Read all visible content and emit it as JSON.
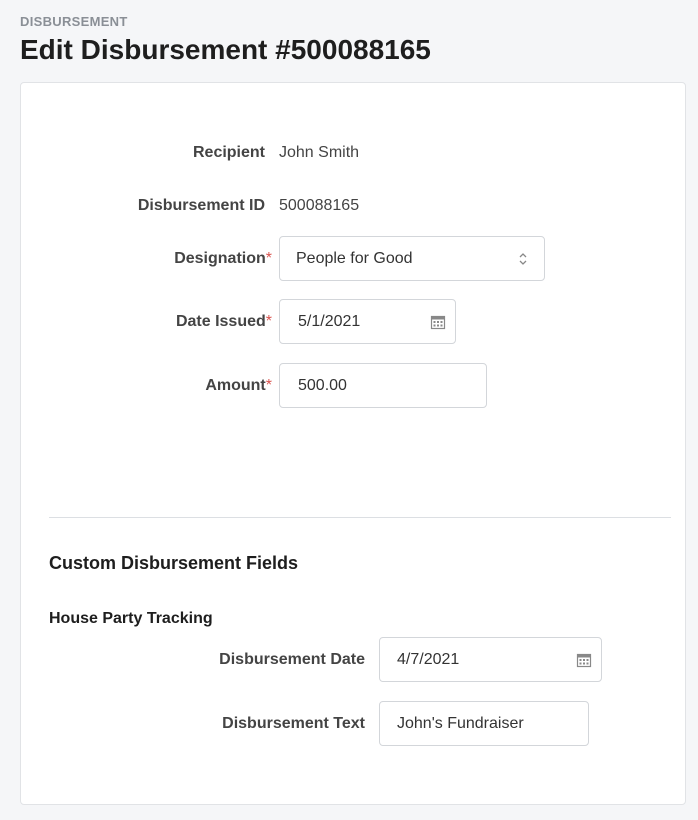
{
  "header": {
    "eyebrow": "DISBURSEMENT",
    "title": "Edit Disbursement #500088165"
  },
  "form": {
    "recipient": {
      "label": "Recipient",
      "value": "John Smith"
    },
    "disbursement_id": {
      "label": "Disbursement ID",
      "value": "500088165"
    },
    "designation": {
      "label": "Designation",
      "required_mark": "*",
      "value": "People for Good"
    },
    "date_issued": {
      "label": "Date Issued",
      "required_mark": "*",
      "value": "5/1/2021"
    },
    "amount": {
      "label": "Amount",
      "required_mark": "*",
      "value": "500.00"
    }
  },
  "custom": {
    "section_title": "Custom Disbursement Fields",
    "subsection_title": "House Party Tracking",
    "disbursement_date": {
      "label": "Disbursement Date",
      "value": "4/7/2021"
    },
    "disbursement_text": {
      "label": "Disbursement Text",
      "value": "John's Fundraiser"
    }
  },
  "icons": {
    "select": "chevron-up-down-icon",
    "calendar": "calendar-icon"
  },
  "colors": {
    "required": "#d9534f",
    "border": "#d3d6da",
    "page_background": "#f5f6f8"
  }
}
